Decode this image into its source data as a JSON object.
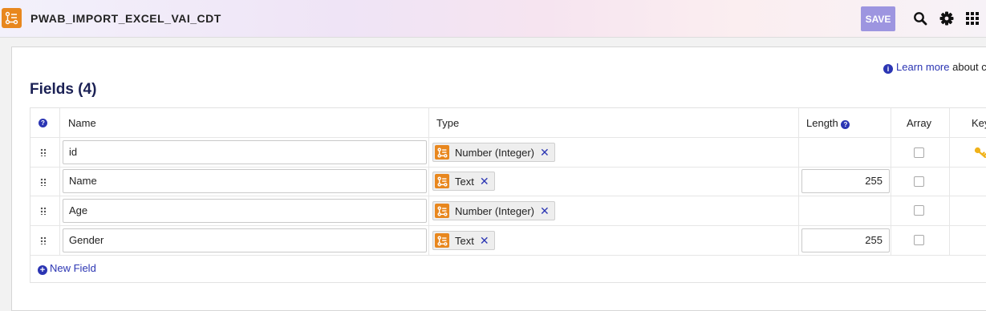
{
  "header": {
    "title": "PWAB_IMPORT_EXCEL_VAI_CDT",
    "save_label": "SAVE",
    "accent_color": "#9d95e0",
    "icons": [
      "data-type-icon",
      "search-icon",
      "gear-icon",
      "apps-grid-icon"
    ]
  },
  "help": {
    "link_text": "Learn more",
    "suffix": "about c"
  },
  "fields": {
    "title": "Fields (4)",
    "columns": {
      "help": "?",
      "name": "Name",
      "type": "Type",
      "length": "Length",
      "array": "Array",
      "key": "Key"
    },
    "rows": [
      {
        "name": "id",
        "type": "Number (Integer)",
        "length": "",
        "array": false,
        "key": true
      },
      {
        "name": "Name",
        "type": "Text",
        "length": "255",
        "array": false,
        "key": false
      },
      {
        "name": "Age",
        "type": "Number (Integer)",
        "length": "",
        "array": false,
        "key": false
      },
      {
        "name": "Gender",
        "type": "Text",
        "length": "255",
        "array": false,
        "key": false
      }
    ],
    "remove_symbol": "✕",
    "new_field_label": "New Field"
  }
}
